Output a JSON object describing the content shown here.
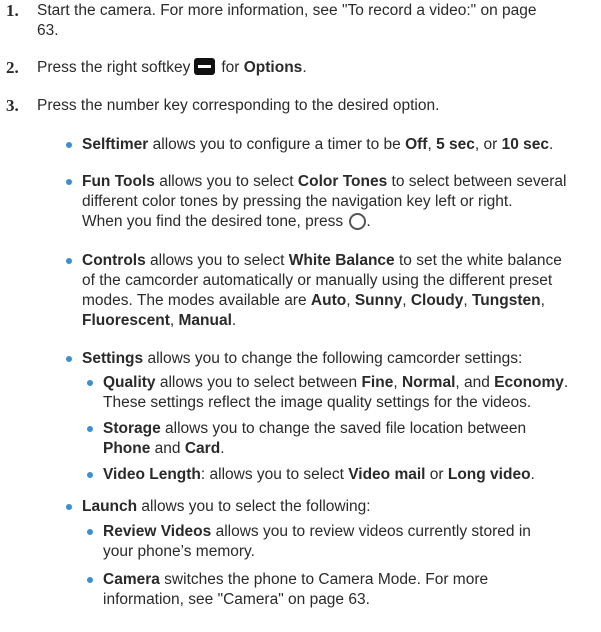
{
  "steps": [
    {
      "number": "1.",
      "line1": "Start the camera. For more information, see \"To record a video:\" on page",
      "line2": "63."
    },
    {
      "number": "2.",
      "pre": "Press the right softkey",
      "icon": "right-softkey-icon",
      "mid": "for",
      "bold": "Options",
      "post": "."
    },
    {
      "number": "3.",
      "text": "Press the number key corresponding to the desired option."
    }
  ],
  "options": {
    "selftimer": {
      "name": "Selftimer",
      "t1": " allows you to configure a timer to be ",
      "v1": "Off",
      "t2": ", ",
      "v2": "5 sec",
      "t3": ", or ",
      "v3": "10 sec",
      "t4": "."
    },
    "fun_tools": {
      "name": "Fun Tools",
      "t1": " allows you to select ",
      "v1": "Color Tones",
      "t2": " to select between several",
      "line2": "different color tones by pressing the navigation key left or right.",
      "line3": "When you find the desired tone, press",
      "icon": "ok-key-icon",
      "end": "."
    },
    "controls": {
      "name": "Controls",
      "t1": " allows you to select ",
      "v1": "White Balance",
      "t2": " to set the white balance",
      "line2": "of the camcorder automatically or manually using the different preset",
      "line3_pre": "modes. The modes available are ",
      "m1": "Auto",
      "m2": "Sunny",
      "m3": "Cloudy",
      "m4": "Tungsten",
      "m5": "Fluorescent",
      "m6": "Manual",
      "sep": ", ",
      "end": "."
    },
    "settings": {
      "name": "Settings",
      "t1": " allows you to change the following camcorder settings:",
      "quality": {
        "name": "Quality",
        "t1": " allows you to select between ",
        "v1": "Fine",
        "t2": ", ",
        "v2": "Normal",
        "t3": ", and ",
        "v3": "Economy",
        "t4": ".",
        "line2": "These settings reflect the image quality settings for the videos."
      },
      "storage": {
        "name": "Storage",
        "t1": " allows you to change the saved file location between",
        "v1": "Phone",
        "t2": " and ",
        "v2": "Card",
        "t3": "."
      },
      "video_length": {
        "name": "Video Length",
        "t1": ": allows you to select ",
        "v1": "Video mail",
        "t2": " or ",
        "v2": "Long video",
        "t3": "."
      }
    },
    "launch": {
      "name": "Launch",
      "t1": " allows you to select the following:",
      "review": {
        "name": "Review Videos",
        "t1": " allows you to review videos currently stored in",
        "line2": "your phone’s memory."
      },
      "camera": {
        "name": "Camera",
        "t1": " switches the phone to Camera Mode. For more",
        "line2": "information, see \"Camera\" on page 63."
      }
    }
  },
  "colors": {
    "text": "#2a2a2a",
    "bullet": "#3c8fd0"
  }
}
